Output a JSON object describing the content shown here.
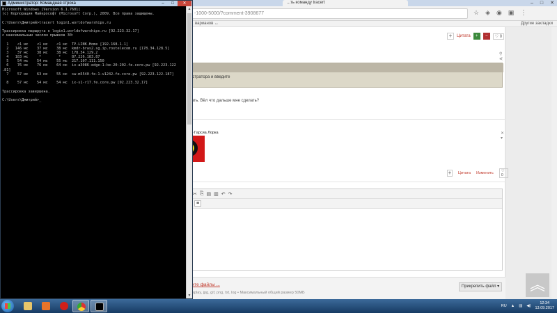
{
  "browser": {
    "tab_title": "...ть команду tracert",
    "window_controls": [
      "–",
      "□",
      "✕"
    ],
    "url": "-1000-5000/?comment-3908677",
    "bookmarks_left": "варианов ↔",
    "bookmarks_right": "Другие закладки",
    "post1": {
      "cite_label": "Цитата",
      "likes": "0"
    },
    "quote_text": "истратора и введите",
    "post_text": "вать. Вёл что дальше мне сделать?",
    "author": "ко Гарсиа Лорка",
    "post2": {
      "cite_label": "Цитата",
      "edit_label": "Изменить",
      "likes": "0"
    },
    "attach_link": "рите файлы ...",
    "attach_hint": "display, jpg, gif, png, txt, log • Максимальный общий размер 50МБ",
    "attach_button": "Прикрепить файл ▾"
  },
  "cmd": {
    "title": "Администратор: Командная строка",
    "lines": [
      "Microsoft Windows [Version 6.1.7601]",
      "(c) Корпорация Майкрософт (Microsoft Corp.), 2009. Все права защищены.",
      "",
      "C:\\Users\\Дмитрий>tracert login1.worldofwarships.ru",
      "",
      "Трассировка маршрута к login1.worldofwarships.ru [92.223.32.17]",
      "с максимальным числом прыжков 30:",
      "",
      "  1    <1 мс    <1 мс    <1 мс  TP-LINK.Home [192.168.1.1]",
      "  2   146 мс    37 мс    38 мс  kmdr-bras2.sg.ip.rostelecom.ru [178.34.128.5]",
      "  3    37 мс    38 мс    38 мс  178.34.129.2",
      "  4   183 мс     *        *     87.226.183.87",
      "  5    54 мс    54 мс    55 мс  217.107.111.150",
      "  6    76 мс    76 мс    64 мс  ix-a3086-edge-1-be-20-202.fe.core.pw [92.223.122",
      ".81]",
      "  7    57 мс    63 мс    55 мс  sw-m5540-fe-1-v1242.fe.core.pw [92.223.122.187]",
      "",
      "  8    57 мс    54 мс    54 мс  ix-s1-r17.fe.core.pw [92.223.32.17]",
      "",
      "Трассировка завершена.",
      "",
      "C:\\Users\\Дмитрий>_"
    ]
  },
  "taskbar": {
    "lang": "RU",
    "time": "12:34",
    "date": "13.09.2017"
  }
}
